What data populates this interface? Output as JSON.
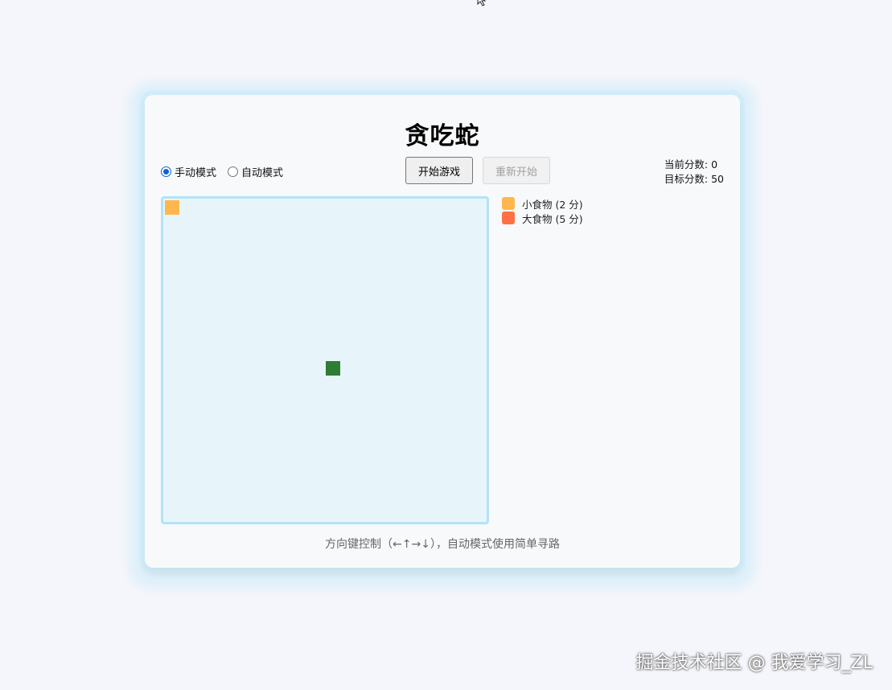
{
  "game": {
    "title": "贪吃蛇",
    "modes": [
      {
        "label": "手动模式",
        "checked": true
      },
      {
        "label": "自动模式",
        "checked": false
      }
    ],
    "start_button": "开始游戏",
    "restart_button": "重新开始",
    "score": {
      "current_label": "当前分数: 0",
      "target_label": "目标分数: 50"
    },
    "legend": [
      {
        "label": "小食物 (2 分)",
        "color": "#ffb74d"
      },
      {
        "label": "大食物 (5 分)",
        "color": "#ff7043"
      }
    ],
    "hint": "方向键控制（←↑→↓），自动模式使用简单寻路",
    "colors": {
      "snake": "#2e7d32",
      "board_bg": "#e7f5fb",
      "board_border": "#b3e3f7"
    }
  },
  "watermark": "掘金技术社区 @ 我爱学习_ZL"
}
